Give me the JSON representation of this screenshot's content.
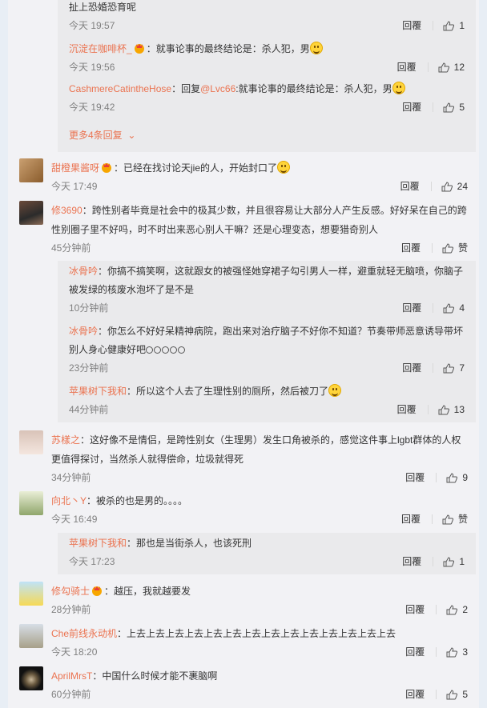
{
  "thread_top": {
    "tail_text": "扯上恐婚恐育呢",
    "tail_time": "今天 19:57",
    "tail_likes": "1",
    "replies": [
      {
        "name": "沉淀在咖啡杯_",
        "text": "：就事论事的最终结论是：杀人犯，男",
        "time": "今天 19:56",
        "likes": "12"
      },
      {
        "name": "CashmereCatintheHose",
        "prefix": "：回复",
        "mention": "@Lvc66",
        "text": ":就事论事的最终结论是：杀人犯，男",
        "time": "今天 19:42",
        "likes": "5"
      }
    ],
    "more_label": "更多4条回复"
  },
  "labels": {
    "reply": "回覆",
    "like_word": "赞"
  },
  "comments": [
    {
      "name": "甜橙果酱呀",
      "text": "：已经在找讨论天jie的人，开始封口了",
      "time": "今天 17:49",
      "likes": "24"
    },
    {
      "name": "修3690",
      "text": "：跨性别者毕竟是社会中的极其少数，并且很容易让大部分人产生反感。好好呆在自己的跨性别圈子里不好吗，时不时出来恶心别人干嘛？还是心理变态，想要猎奇别人",
      "time": "45分钟前",
      "likes": "赞",
      "replies": [
        {
          "name": "冰骨吟",
          "text": "：你搞不搞笑啊，这就跟女的被强怪她穿裙子勾引男人一样，避重就轻无脑喷，你脑子被发绿的核废水泡坏了是不是",
          "time": "10分钟前",
          "likes": "4"
        },
        {
          "name": "冰骨吟",
          "text": "：你怎么不好好呆精神病院，跑出来对治疗脑子不好你不知道？节奏带师恶意诱导带坏别人身心健康好吧",
          "time": "23分钟前",
          "likes": "7"
        },
        {
          "name": "苹果树下我和",
          "text": "：所以这个人去了生理性别的厕所，然后被刀了",
          "time": "44分钟前",
          "likes": "13"
        }
      ]
    },
    {
      "name": "苏樣之",
      "text": "：这好像不是情侣，是跨性别女（生理男）发生口角被杀的，感觉这件事上lgbt群体的人权更值得探讨，当然杀人就得偿命，垃圾就得死",
      "time": "34分钟前",
      "likes": "9"
    },
    {
      "name": "向北丶Y",
      "text": "：被杀的也是男的。。。。",
      "time": "今天 16:49",
      "likes": "赞",
      "replies": [
        {
          "name": "苹果树下我和",
          "text": "：那也是当街杀人，也该死刑",
          "time": "今天 17:23",
          "likes": "1"
        }
      ]
    },
    {
      "name": "修勾骑士",
      "text": "：越压，我就越要发",
      "time": "28分钟前",
      "likes": "2"
    },
    {
      "name": "Che前线永动机",
      "text": "：上去上去上去上去上去上去上去上去上去上去上去上去上去上去",
      "time": "今天 18:20",
      "likes": "3"
    },
    {
      "name": "AprilMrsT",
      "text": "：中国什么时候才能不裹脑啊",
      "time": "60分钟前",
      "likes": "5"
    }
  ]
}
